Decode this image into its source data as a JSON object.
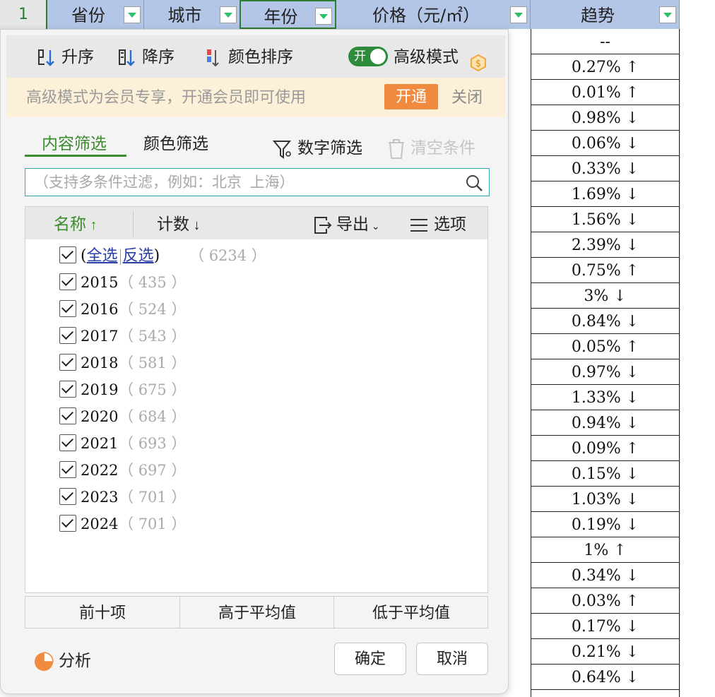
{
  "sheet": {
    "row_header": "1",
    "columns": [
      {
        "label": "省份"
      },
      {
        "label": "城市"
      },
      {
        "label": "年份"
      },
      {
        "label": "价格（元/㎡）"
      },
      {
        "label": "趋势"
      }
    ],
    "trend_values": [
      "--",
      "0.27% ↑",
      "0.01% ↑",
      "0.98% ↓",
      "0.06% ↓",
      "0.33% ↓",
      "1.69% ↓",
      "1.56% ↓",
      "2.39% ↓",
      "0.75% ↑",
      "3% ↓",
      "0.84% ↓",
      "0.05% ↑",
      "0.97% ↓",
      "1.33% ↓",
      "0.94% ↓",
      "0.09% ↑",
      "0.15% ↓",
      "1.03% ↓",
      "0.19% ↓",
      "1% ↑",
      "0.34% ↓",
      "0.03% ↑",
      "0.17% ↓",
      "0.21% ↓",
      "0.64% ↓"
    ]
  },
  "panel": {
    "sort": {
      "asc": "升序",
      "desc": "降序",
      "color_sort": "颜色排序",
      "toggle_text": "开",
      "advanced_mode": "高级模式"
    },
    "notice": {
      "text": "高级模式为会员专享，开通会员即可使用",
      "open": "开通",
      "close": "关闭"
    },
    "tabs": {
      "content": "内容筛选",
      "color": "颜色筛选",
      "number": "数字筛选",
      "clear": "清空条件"
    },
    "search_placeholder": "（支持多条件过滤，例如：北京  上海）",
    "list_header": {
      "name": "名称",
      "count": "计数",
      "export": "导出",
      "options": "选项"
    },
    "select_all": "全选",
    "invert": "反选",
    "total_count": "6234",
    "items": [
      {
        "label": "2015",
        "count": "435"
      },
      {
        "label": "2016",
        "count": "524"
      },
      {
        "label": "2017",
        "count": "543"
      },
      {
        "label": "2018",
        "count": "581"
      },
      {
        "label": "2019",
        "count": "675"
      },
      {
        "label": "2020",
        "count": "684"
      },
      {
        "label": "2021",
        "count": "693"
      },
      {
        "label": "2022",
        "count": "697"
      },
      {
        "label": "2023",
        "count": "701"
      },
      {
        "label": "2024",
        "count": "701"
      }
    ],
    "quick": {
      "top10": "前十项",
      "above_avg": "高于平均值",
      "below_avg": "低于平均值"
    },
    "analysis": "分析",
    "ok": "确定",
    "cancel": "取消"
  },
  "colors": {
    "accent_green": "#3d8b2f",
    "header_blue": "#b4c6e7",
    "open_orange": "#f08a3e",
    "notice_bg": "#fdf0d8"
  }
}
